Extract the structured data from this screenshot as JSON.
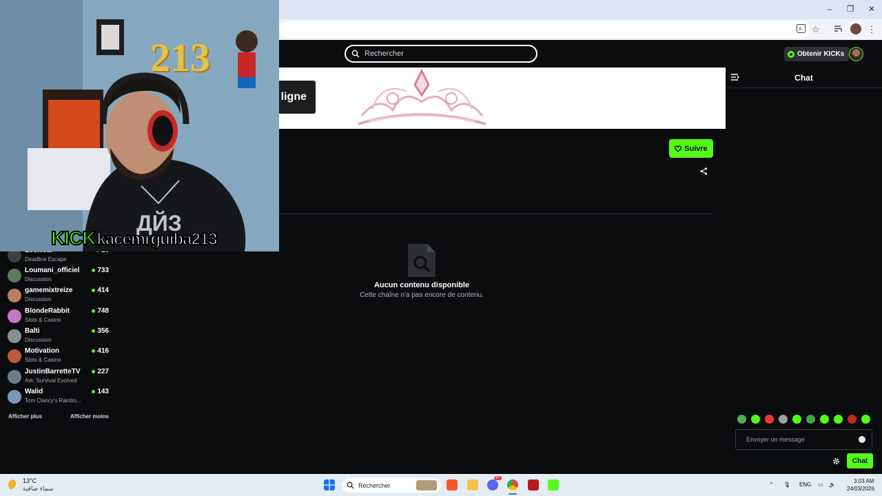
{
  "browser": {
    "window_controls": [
      "–",
      "❐",
      "✕"
    ]
  },
  "topnav": {
    "search_placeholder": "Rechercher",
    "kicks_button": "Obtenir KICKs"
  },
  "banner": {
    "offline_label": "ligne"
  },
  "chat": {
    "title": "Chat",
    "input_placeholder": "Envoyer un message",
    "send_label": "Chat"
  },
  "channel": {
    "follow_label": "Suivre"
  },
  "empty_state": {
    "title": "Aucun contenu disponible",
    "subtitle": "Cette chaîne n'a pas encore de contenu."
  },
  "webcam": {
    "overlay_brand": "KICK",
    "overlay_handle": "kacemrguiba213",
    "wall_number": "213"
  },
  "sidebar": {
    "channels": [
      {
        "name": "Lockleaf",
        "category": "Deadline Escape",
        "viewers": "16",
        "avatar_color": "#3c3f44"
      },
      {
        "name": "Loumani_officiel",
        "category": "Discussion",
        "viewers": "733",
        "avatar_color": "#5b7a5e"
      },
      {
        "name": "gamemixtreize",
        "category": "Discussion",
        "viewers": "414",
        "avatar_color": "#b7805e"
      },
      {
        "name": "BlondeRabbit",
        "category": "Slots & Casino",
        "viewers": "748",
        "avatar_color": "#c878c0"
      },
      {
        "name": "Balti",
        "category": "Discussion",
        "viewers": "356",
        "avatar_color": "#8a8f96"
      },
      {
        "name": "Motivation",
        "category": "Slots & Casino",
        "viewers": "416",
        "avatar_color": "#c05a3a"
      },
      {
        "name": "JustinBarretteTV",
        "category": "Ark: Survival Evolved",
        "viewers": "227",
        "avatar_color": "#6f7a8a"
      },
      {
        "name": "Walid",
        "category": "Tom Clancy's Rainbo...",
        "viewers": "143",
        "avatar_color": "#7a96b8"
      }
    ],
    "show_more": "Afficher plus",
    "show_less": "Afficher moins"
  },
  "taskbar": {
    "weather_temp": "13°C",
    "weather_desc": "سماء صافية",
    "search_label": "Rechercher",
    "language": "ENG",
    "time": "3:03 AM",
    "date": "24/03/2026",
    "discord_badge": "9+"
  },
  "colors": {
    "accent": "#53fc18",
    "background": "#0b0c0e"
  }
}
